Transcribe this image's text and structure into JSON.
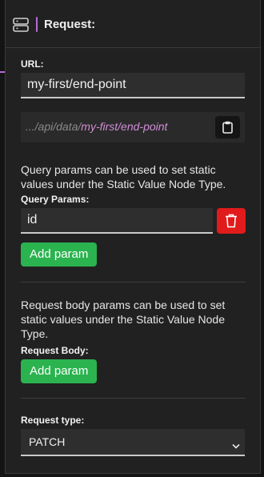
{
  "header": {
    "title": "Request:",
    "icon": "server-icon",
    "accent_color": "#b46bd6"
  },
  "url_section": {
    "label": "URL:",
    "value": "my-first/end-point",
    "preview_prefix": ".../api/data/",
    "preview_path": "my-first/end-point",
    "copy_icon": "clipboard-icon"
  },
  "query_section": {
    "description": "Query params can be used to set static values under the Static Value Node Type.",
    "label": "Query Params:",
    "params": [
      "id"
    ],
    "delete_icon": "trash-icon",
    "add_label": "Add param"
  },
  "body_section": {
    "description": "Request body params can be used to set static values under the Static Value Node Type.",
    "label": "Request Body:",
    "add_label": "Add param"
  },
  "request_type": {
    "label": "Request type:",
    "selected": "PATCH"
  },
  "colors": {
    "add_button": "#2ab34f",
    "delete_button": "#e11b1b",
    "path_highlight": "#d28ed8"
  }
}
